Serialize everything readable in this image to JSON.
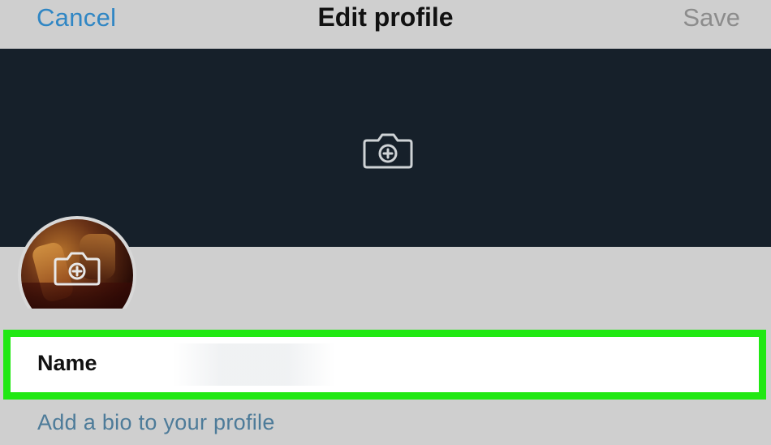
{
  "topbar": {
    "cancel_label": "Cancel",
    "title": "Edit profile",
    "save_label": "Save"
  },
  "header_banner": {
    "icon": "camera-plus-icon"
  },
  "avatar": {
    "icon": "camera-plus-icon"
  },
  "form": {
    "name_label": "Name",
    "bio_placeholder": "Add a bio to your profile"
  },
  "colors": {
    "accent": "#2f86c4",
    "banner": "#16202a",
    "highlight": "#21e813",
    "background": "#cfcfcf",
    "save_disabled": "#8c8c8c"
  }
}
